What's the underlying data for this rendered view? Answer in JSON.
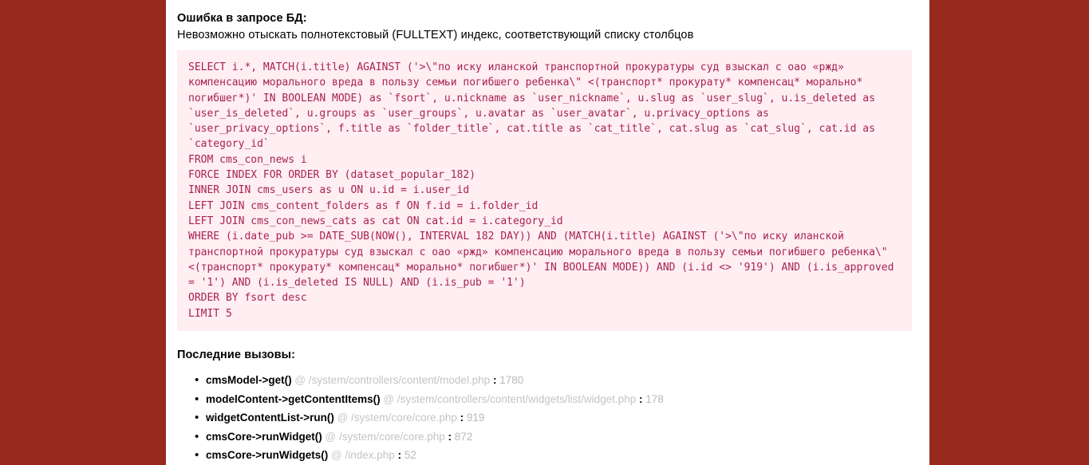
{
  "theme": {
    "outer_background": "#97291d",
    "page_background": "#ffffff",
    "sql_box_background": "#ffeef2",
    "sql_text_color": "#a72353",
    "path_color": "#c4c4c4",
    "text_color": "#000000"
  },
  "error": {
    "title": "Ошибка в запросе БД:",
    "message": "Невозможно отыскать полнотекстовый (FULLTEXT) индекс, соответствующий списку столбцов"
  },
  "sql": {
    "query": "SELECT i.*, MATCH(i.title) AGAINST ('>\\\"по иску иланской транспортной прокуратуры суд взыскал с оао «ржд» компенсацию морального вреда в пользу семьи погибшего ребенка\\\" <(транспорт* прокурату* компенсац* морально* погибшег*)' IN BOOLEAN MODE) as `fsort`, u.nickname as `user_nickname`, u.slug as `user_slug`, u.is_deleted as `user_is_deleted`, u.groups as `user_groups`, u.avatar as `user_avatar`, u.privacy_options as `user_privacy_options`, f.title as `folder_title`, cat.title as `cat_title`, cat.slug as `cat_slug`, cat.id as `category_id`\nFROM cms_con_news i\nFORCE INDEX FOR ORDER BY (dataset_popular_182)\nINNER JOIN cms_users as u ON u.id = i.user_id\nLEFT JOIN cms_content_folders as f ON f.id = i.folder_id\nLEFT JOIN cms_con_news_cats as cat ON cat.id = i.category_id\nWHERE (i.date_pub >= DATE_SUB(NOW(), INTERVAL 182 DAY)) AND (MATCH(i.title) AGAINST ('>\\\"по иску иланской транспортной прокуратуры суд взыскал с оао «ржд» компенсацию морального вреда в пользу семьи погибшего ребенка\\\" <(транспорт* прокурату* компенсац* морально* погибшег*)' IN BOOLEAN MODE)) AND (i.id <> '919') AND (i.is_approved = '1') AND (i.is_deleted IS NULL) AND (i.is_pub = '1')\nORDER BY fsort desc\nLIMIT 5"
  },
  "calls": {
    "title": "Последние вызовы:",
    "at_symbol": "@",
    "separator": ":",
    "items": [
      {
        "fn": "cmsModel->get()",
        "path": "/system/controllers/content/model.php",
        "line": "1780"
      },
      {
        "fn": "modelContent->getContentItems()",
        "path": "/system/controllers/content/widgets/list/widget.php",
        "line": "178"
      },
      {
        "fn": "widgetContentList->run()",
        "path": "/system/core/core.php",
        "line": "919"
      },
      {
        "fn": "cmsCore->runWidget()",
        "path": "/system/core/core.php",
        "line": "872"
      },
      {
        "fn": "cmsCore->runWidgets()",
        "path": "/index.php",
        "line": "52"
      }
    ]
  }
}
